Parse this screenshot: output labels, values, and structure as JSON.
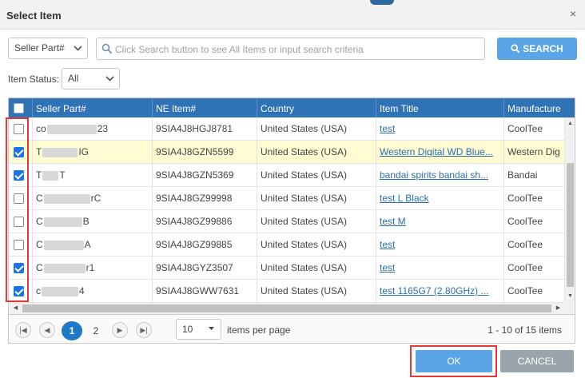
{
  "dialog": {
    "title": "Select Item",
    "close_glyph": "×"
  },
  "search": {
    "field_select": "Seller Part#",
    "placeholder": "Click Search button to see All Items or input search criteria",
    "button_label": "SEARCH"
  },
  "filter": {
    "status_label": "Item Status:",
    "status_value": "All"
  },
  "grid": {
    "columns": [
      "Seller Part#",
      "NE Item#",
      "Country",
      "Item Title",
      "Manufacture"
    ],
    "rows": [
      {
        "checked": false,
        "part_visible": [
          "co",
          "23"
        ],
        "ne_item": "9SIA4J8HGJ8781",
        "country": "United States (USA)",
        "title": "test",
        "manufacturer": "CoolTee"
      },
      {
        "checked": true,
        "part_visible": [
          "T",
          "IG"
        ],
        "ne_item": "9SIA4J8GZN5599",
        "country": "United States (USA)",
        "title": "Western Digital WD Blue...",
        "manufacturer": "Western Dig"
      },
      {
        "checked": true,
        "part_visible": [
          "T",
          "T"
        ],
        "ne_item": "9SIA4J8GZN5369",
        "country": "United States (USA)",
        "title": "bandai spirits bandai sh...",
        "manufacturer": "Bandai"
      },
      {
        "checked": false,
        "part_visible": [
          "C",
          "rC"
        ],
        "ne_item": "9SIA4J8GZ99998",
        "country": "United States (USA)",
        "title": "test L Black",
        "manufacturer": "CoolTee"
      },
      {
        "checked": false,
        "part_visible": [
          "C",
          "B"
        ],
        "ne_item": "9SIA4J8GZ99886",
        "country": "United States (USA)",
        "title": "test M",
        "manufacturer": "CoolTee"
      },
      {
        "checked": false,
        "part_visible": [
          "C",
          "A"
        ],
        "ne_item": "9SIA4J8GZ99885",
        "country": "United States (USA)",
        "title": "test",
        "manufacturer": "CoolTee"
      },
      {
        "checked": true,
        "part_visible": [
          "C",
          "r1"
        ],
        "ne_item": "9SIA4J8GYZ3507",
        "country": "United States (USA)",
        "title": "test",
        "manufacturer": "CoolTee"
      },
      {
        "checked": true,
        "part_visible": [
          "c",
          "4"
        ],
        "ne_item": "9SIA4J8GWW7631",
        "country": "United States (USA)",
        "title": "test 1165G7 (2.80GHz) ...",
        "manufacturer": "CoolTee"
      }
    ]
  },
  "pager": {
    "pages": [
      "1",
      "2"
    ],
    "current_page": "1",
    "per_page_value": "10",
    "per_page_label": "items per page",
    "info": "1 - 10 of 15 items"
  },
  "footer": {
    "ok_label": "OK",
    "cancel_label": "CANCEL"
  },
  "colors": {
    "header_blue": "#2f72b5",
    "button_blue": "#5aa5e6",
    "highlight_red": "#e53935",
    "selected_row": "#fffbd3"
  }
}
